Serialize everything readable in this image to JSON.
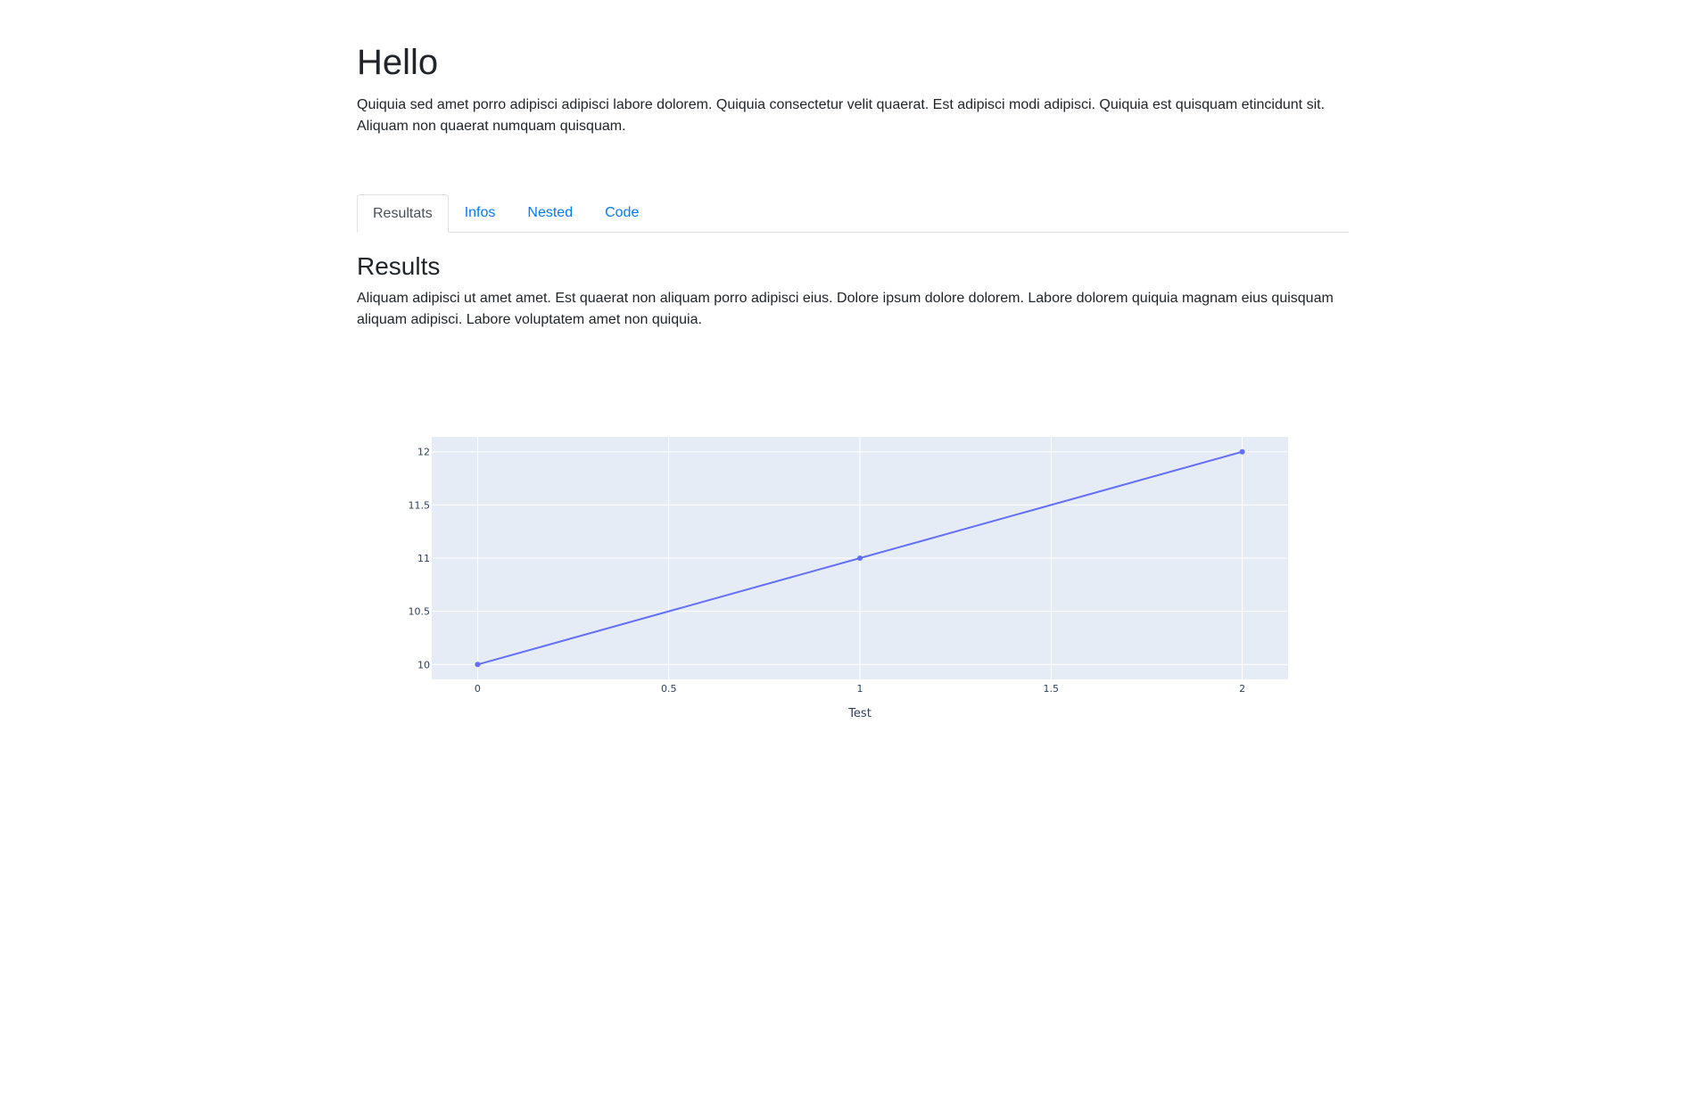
{
  "header": {
    "title": "Hello",
    "intro": "Quiquia sed amet porro adipisci adipisci labore dolorem. Quiquia consectetur velit quaerat. Est adipisci modi adipisci. Quiquia est quisquam etincidunt sit. Aliquam non quaerat numquam quisquam."
  },
  "tabs": [
    {
      "label": "Resultats",
      "active": true
    },
    {
      "label": "Infos",
      "active": false
    },
    {
      "label": "Nested",
      "active": false
    },
    {
      "label": "Code",
      "active": false
    }
  ],
  "section": {
    "title": "Results",
    "text": "Aliquam adipisci ut amet amet. Est quaerat non aliquam porro adipisci eius. Dolore ipsum dolore dolorem. Labore dolorem quiquia magnam eius quisquam aliquam adipisci. Labore voluptatem amet non quiquia."
  },
  "colors": {
    "link": "#007bff",
    "plot_bg": "#e5ecf6",
    "series": "#636efa",
    "axis_text": "#2a3f5f"
  },
  "chart_data": {
    "type": "line",
    "x": [
      0,
      1,
      2
    ],
    "series": [
      {
        "values": [
          10,
          11,
          12
        ]
      }
    ],
    "markers": true,
    "xlabel": "Test",
    "ylabel": "",
    "xlim": [
      -0.12,
      2.12
    ],
    "ylim": [
      9.86,
      12.14
    ],
    "xticks": [
      0,
      0.5,
      1,
      1.5,
      2
    ],
    "xtick_labels": [
      "0",
      "0.5",
      "1",
      "1.5",
      "2"
    ],
    "yticks": [
      10,
      10.5,
      11,
      11.5,
      12
    ],
    "ytick_labels": [
      "10",
      "10.5",
      "11",
      "11.5",
      "12"
    ],
    "grid": true
  }
}
